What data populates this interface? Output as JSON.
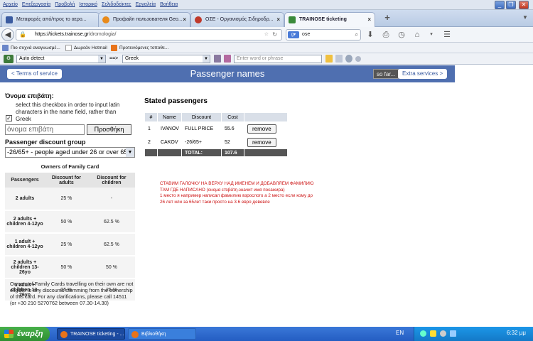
{
  "menubar": {
    "items": [
      "Αρχείο",
      "Επεξεργασία",
      "Προβολή",
      "Ιστορικό",
      "Σελιδοδείκτες",
      "Εργαλεία",
      "Βοήθεια"
    ]
  },
  "tabs": [
    {
      "label": "Μεταφορές από/προς το αερο..."
    },
    {
      "label": "Профайл пользователя Geo..."
    },
    {
      "label": "ΟΣΕ - Οργανισμός Σιδηροδρ..."
    },
    {
      "label": "TRAINOSE ticketing"
    }
  ],
  "nav": {
    "url_host": "https://tickets.trainose.gr",
    "url_path": "/dromologia/",
    "search_value": "ose"
  },
  "bookmarks": [
    "Πιο συχνά αναγνωσμέ...",
    "Δωρεάν Hotmail",
    "Προτεινόμενες τοποθε..."
  ],
  "translate": {
    "source": "Auto detect",
    "arrow": "==>",
    "target": "Greek",
    "placeholder": "Enter word or phrase"
  },
  "page": {
    "terms_button": "< Terms of service",
    "title": "Passenger names",
    "so_far": "so far...",
    "extra_button": "Extra services >",
    "name_heading": "Όνομα επιβάτη:",
    "checkbox_text": "select this checkbox in order to input latin characters in the name field, rather than Greek",
    "name_placeholder": "όνομα επιβάτη",
    "add_button": "Προσθήκη",
    "discount_heading": "Passenger discount group",
    "discount_selected": "-26/65+ - people aged under 26 or over 65",
    "family_caption": "Owners of Family Card",
    "family_headers": [
      "Passengers",
      "Discount for adults",
      "Discount for children"
    ],
    "family_rows": [
      {
        "label": "2 adults",
        "adults": "25 %",
        "children": "-"
      },
      {
        "label": "2 adults + children 4-12yo",
        "adults": "50 %",
        "children": "62.5 %"
      },
      {
        "label": "1 adult + children 4-12yo",
        "adults": "25 %",
        "children": "62.5 %"
      },
      {
        "label": "2 adults + children 13-26yo",
        "adults": "50 %",
        "children": "50 %"
      },
      {
        "label": "1 adult + children 13-26yo",
        "adults": "25 %",
        "children": "25 %"
      }
    ],
    "family_note": "Owners of Family Cards travelling on their own are not eligible to any discounts stemming from the ownership of this card. For any clarifications, please call 14511 (or +30 210 5270762 between 07.30-14.30)",
    "stated_heading": "Stated passengers",
    "pass_headers": [
      "#",
      "Name",
      "Discount",
      "Cost",
      ""
    ],
    "passengers": [
      {
        "n": "1",
        "name": "IVANOV",
        "discount": "FULL PRICE",
        "cost": "55.6",
        "action": "remove"
      },
      {
        "n": "2",
        "name": "CAKOV",
        "discount": "-26/65+",
        "cost": "52",
        "action": "remove"
      }
    ],
    "total_label": "TOTAL:",
    "total_value": "107.6",
    "note_lines": [
      "СТАВИМ ГАЛОЧКУ НА ВЕРХУ НАД ИМЕНЕМ И ДОБАВЛЯЕМ ФАМИЛИЮ",
      "ТАМ ГДЕ НАПИСАНО (онομα επιβάτη-значит имя посажира)",
      "1 место я например написал фамилию взрослого а 2   место если  кому до",
      "26 лет или за 65лет тaки просто на 3.6 евро девевле"
    ]
  },
  "taskbar": {
    "start": "έναρξη",
    "tasks": [
      "TRAINOSE ticketing - ...",
      "Βιβλιοθήκη"
    ],
    "lang": "EN",
    "time": "6:32 μμ"
  },
  "colors": {
    "site_bar": "#4f6fb0",
    "note_red": "#cc1111",
    "taskbar": "#245dc2",
    "start": "#2f8f31"
  }
}
